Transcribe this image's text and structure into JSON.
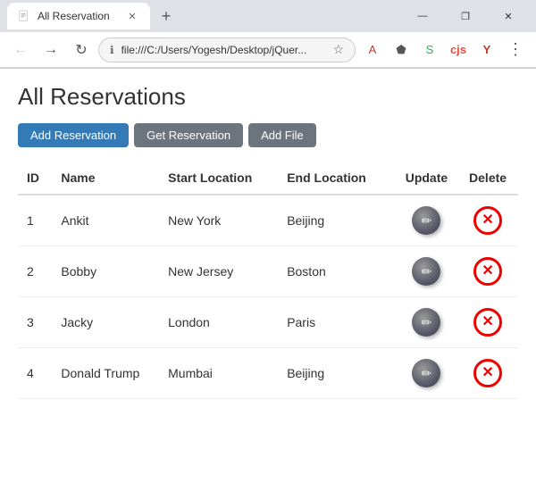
{
  "browser": {
    "tab_title": "All Reservation",
    "tab_new": "+",
    "address": "file:///C:/Users/Yogesh/Desktop/jQuer...",
    "win_minimize": "—",
    "win_restore": "❐",
    "win_close": "✕"
  },
  "page": {
    "title": "All Reservations",
    "buttons": {
      "add": "Add Reservation",
      "get": "Get Reservation",
      "file": "Add File"
    },
    "table": {
      "headers": [
        "ID",
        "Name",
        "Start Location",
        "End Location",
        "Update",
        "Delete"
      ],
      "rows": [
        {
          "id": "1",
          "name": "Ankit",
          "start": "New York",
          "end": "Beijing"
        },
        {
          "id": "2",
          "name": "Bobby",
          "start": "New Jersey",
          "end": "Boston"
        },
        {
          "id": "3",
          "name": "Jacky",
          "start": "London",
          "end": "Paris"
        },
        {
          "id": "4",
          "name": "Donald Trump",
          "start": "Mumbai",
          "end": "Beijing"
        }
      ]
    }
  }
}
